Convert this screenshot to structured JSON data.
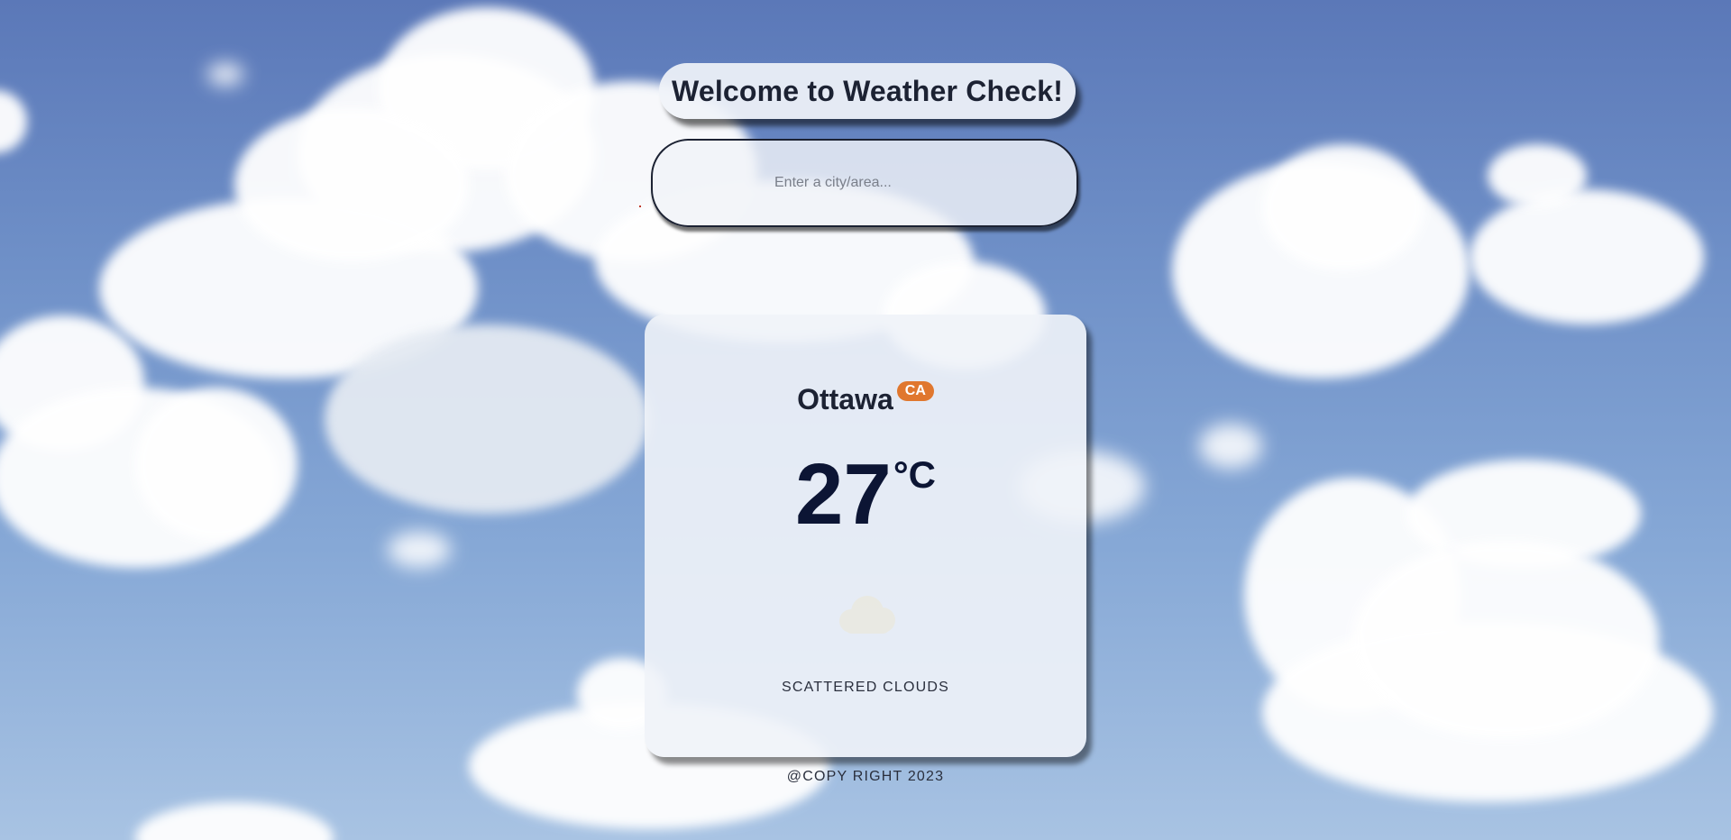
{
  "header": {
    "title": "Welcome to Weather Check!"
  },
  "search": {
    "placeholder": "Enter a city/area...",
    "value": ""
  },
  "weather": {
    "city": "Ottawa",
    "country": "CA",
    "temperature": "27",
    "unit": "°C",
    "condition": "SCATTERED CLOUDS",
    "icon": "cloud-icon"
  },
  "footer": {
    "text": "@COPY RIGHT 2023"
  },
  "colors": {
    "sky_top": "#5b78b8",
    "sky_bottom": "#a8c3e3",
    "card_bg": "#f0f3f8",
    "badge": "#e0772e",
    "temperature_text": "#0c1534"
  }
}
